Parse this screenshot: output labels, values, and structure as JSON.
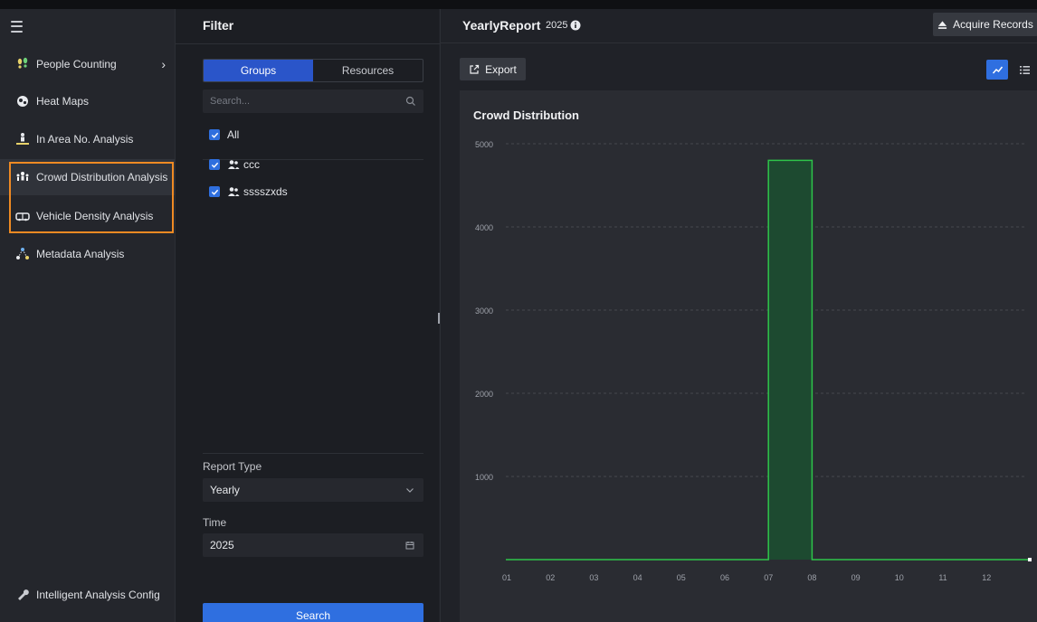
{
  "sidebar": {
    "items": [
      {
        "label": "People Counting",
        "icon": "footprints-icon",
        "has_chevron": true
      },
      {
        "label": "Heat Maps",
        "icon": "heatmap-icon"
      },
      {
        "label": "In Area No. Analysis",
        "icon": "person-area-icon"
      },
      {
        "label": "Crowd Distribution Analysis",
        "icon": "crowd-icon",
        "active": true
      },
      {
        "label": "Vehicle Density Analysis",
        "icon": "car-icon"
      },
      {
        "label": "Metadata Analysis",
        "icon": "nodes-icon"
      }
    ],
    "footer_item": {
      "label": "Intelligent Analysis Config",
      "icon": "config-icon"
    },
    "highlight_color": "#ef8a23"
  },
  "filter": {
    "title": "Filter",
    "tabs": [
      "Groups",
      "Resources"
    ],
    "active_tab": "Groups",
    "search_placeholder": "Search...",
    "all_label": "All",
    "groups": [
      "ccc",
      "sssszxds"
    ],
    "report_type_label": "Report Type",
    "report_type_value": "Yearly",
    "time_label": "Time",
    "time_value": "2025",
    "search_button": "Search"
  },
  "report": {
    "title": "YearlyReport",
    "year": "2025",
    "acquire_button": "Acquire Records",
    "export_button": "Export",
    "active_view": "line-chart-icon"
  },
  "colors": {
    "accent": "#2f6fe0",
    "series": "#2ec44a",
    "series_fill": "#1d4a30"
  },
  "chart_data": {
    "type": "area",
    "title": "Crowd Distribution",
    "categories": [
      "01",
      "02",
      "03",
      "04",
      "05",
      "06",
      "07",
      "08",
      "09",
      "10",
      "11",
      "12"
    ],
    "series": [
      {
        "values": [
          0,
          0,
          0,
          0,
          0,
          0,
          4800,
          0,
          0,
          0,
          0,
          0
        ]
      }
    ],
    "yticks": [
      1000,
      2000,
      3000,
      4000,
      5000
    ],
    "ylim": [
      0,
      5000
    ],
    "step": true,
    "grid": "horizontal-dashed"
  }
}
